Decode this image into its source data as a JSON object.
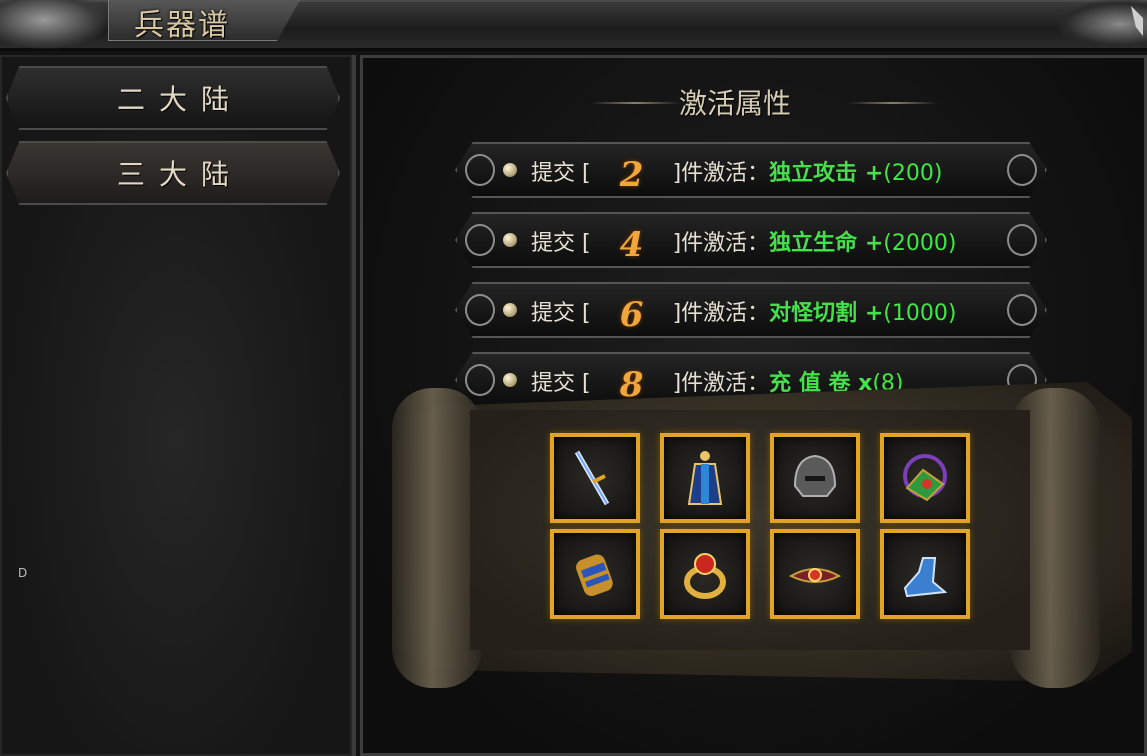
{
  "window": {
    "title": "兵器谱"
  },
  "nav": {
    "items": [
      {
        "label": "二大陆",
        "active": false
      },
      {
        "label": "三大陆",
        "active": true
      }
    ]
  },
  "side_label": "D",
  "section": {
    "heading": "激活属性"
  },
  "rows": [
    {
      "prefix": "提交 [",
      "count": "2",
      "suffix": "]件激活：",
      "attr": "独立攻击 +",
      "value": "(200)"
    },
    {
      "prefix": "提交 [",
      "count": "4",
      "suffix": "]件激活：",
      "attr": "独立生命 +",
      "value": "(2000)"
    },
    {
      "prefix": "提交 [",
      "count": "6",
      "suffix": "]件激活：",
      "attr": "对怪切割 +",
      "value": "(1000)"
    },
    {
      "prefix": "提交 [",
      "count": "8",
      "suffix": "]件激活：",
      "attr": "充 值 卷 x",
      "value": "(8)"
    }
  ],
  "items": [
    {
      "icon": "sword-icon"
    },
    {
      "icon": "armor-icon"
    },
    {
      "icon": "helmet-icon"
    },
    {
      "icon": "necklace-icon"
    },
    {
      "icon": "bracer-icon"
    },
    {
      "icon": "ring-icon"
    },
    {
      "icon": "belt-icon"
    },
    {
      "icon": "boots-icon"
    }
  ],
  "colors": {
    "accent": "#e1a426",
    "attr_green": "#46e04c",
    "count_orange": "#f0a63a",
    "text": "#e5e0d2"
  }
}
